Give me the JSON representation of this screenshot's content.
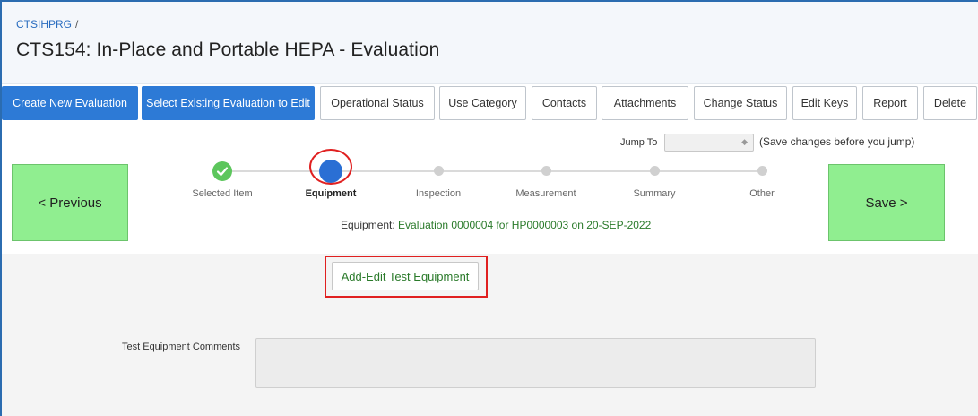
{
  "header": {
    "breadcrumb_link": "CTSIHPRG",
    "breadcrumb_sep": "/",
    "title": "CTS154: In-Place and Portable HEPA - Evaluation"
  },
  "toolbar": {
    "buttons": [
      {
        "label": "Create New Evaluation",
        "primary": true
      },
      {
        "label": "Select Existing Evaluation to Edit",
        "primary": true
      },
      {
        "label": "Operational Status"
      },
      {
        "label": "Use Category"
      },
      {
        "label": "Contacts"
      },
      {
        "label": "Attachments"
      },
      {
        "label": "Change Status"
      },
      {
        "label": "Edit Keys"
      },
      {
        "label": "Report"
      },
      {
        "label": "Delete"
      }
    ]
  },
  "jump": {
    "label": "Jump To",
    "selected": "",
    "hint": "(Save changes before you jump)"
  },
  "navigation": {
    "previous_label": "< Previous",
    "save_label": "Save >"
  },
  "steps": [
    {
      "label": "Selected Item",
      "state": "complete"
    },
    {
      "label": "Equipment",
      "state": "active"
    },
    {
      "label": "Inspection",
      "state": "pending"
    },
    {
      "label": "Measurement",
      "state": "pending"
    },
    {
      "label": "Summary",
      "state": "pending"
    },
    {
      "label": "Other",
      "state": "pending"
    }
  ],
  "context": {
    "prefix": "Equipment: ",
    "value": "Evaluation 0000004 for HP0000003 on 20-SEP-2022"
  },
  "equipment": {
    "add_edit_label": "Add-Edit Test Equipment",
    "comments_label": "Test Equipment Comments",
    "comments_value": ""
  },
  "colors": {
    "primary": "#2d7ad6",
    "nav_green": "#90ee90",
    "highlight_red": "#e02020",
    "complete_green": "#5cc65c"
  }
}
